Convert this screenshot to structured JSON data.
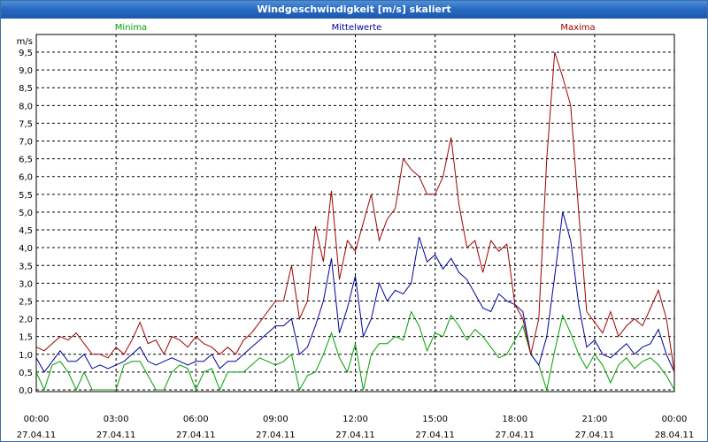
{
  "window": {
    "title": "Windgeschwindigkeit [m/s] skaliert"
  },
  "colors": {
    "titlebar": "#2a6bc2",
    "minima": "#00a000",
    "mittelwerte": "#0000a0",
    "maxima": "#a00000",
    "grid": "#000000"
  },
  "chart_data": {
    "type": "line",
    "title": "Windgeschwindigkeit [m/s] skaliert",
    "ylabel": "m/s",
    "ylim": [
      0,
      9.5
    ],
    "yticks": [
      "0,0",
      "0,5",
      "1,0",
      "1,5",
      "2,0",
      "2,5",
      "3,0",
      "3,5",
      "4,0",
      "4,5",
      "5,0",
      "5,5",
      "6,0",
      "6,5",
      "7,0",
      "7,5",
      "8,0",
      "8,5",
      "9,0",
      "9,5"
    ],
    "xlim_hours": [
      0,
      24
    ],
    "xticks": [
      {
        "time": "00:00",
        "date": "27.04.11"
      },
      {
        "time": "03:00",
        "date": "27.04.11"
      },
      {
        "time": "06:00",
        "date": "27.04.11"
      },
      {
        "time": "09:00",
        "date": "27.04.11"
      },
      {
        "time": "12:00",
        "date": "27.04.11"
      },
      {
        "time": "15:00",
        "date": "27.04.11"
      },
      {
        "time": "18:00",
        "date": "27.04.11"
      },
      {
        "time": "21:00",
        "date": "27.04.11"
      },
      {
        "time": "00:00",
        "date": "28.04.11"
      }
    ],
    "grid": true,
    "legend_position": "top",
    "series": [
      {
        "name": "Minima",
        "color": "#00a000",
        "x": [
          0,
          0.3,
          0.6,
          0.9,
          1.2,
          1.5,
          1.8,
          2.1,
          2.4,
          2.7,
          3.0,
          3.3,
          3.6,
          3.9,
          4.2,
          4.5,
          4.8,
          5.1,
          5.4,
          5.7,
          6.0,
          6.3,
          6.6,
          6.9,
          7.2,
          7.5,
          7.8,
          8.1,
          8.4,
          8.7,
          9.0,
          9.3,
          9.6,
          9.9,
          10.2,
          10.5,
          10.8,
          11.1,
          11.4,
          11.7,
          12.0,
          12.3,
          12.6,
          12.9,
          13.2,
          13.5,
          13.8,
          14.1,
          14.4,
          14.7,
          15.0,
          15.3,
          15.6,
          15.9,
          16.2,
          16.5,
          16.8,
          17.1,
          17.4,
          17.7,
          18.0,
          18.3,
          18.6,
          18.9,
          19.2,
          19.5,
          19.8,
          20.1,
          20.4,
          20.7,
          21.0,
          21.3,
          21.6,
          21.9,
          22.2,
          22.5,
          22.8,
          23.1,
          23.4,
          23.7,
          24.0
        ],
        "values": [
          0.5,
          0.0,
          0.7,
          0.8,
          0.5,
          0.0,
          0.5,
          0.0,
          0.0,
          0.0,
          0.0,
          0.7,
          0.8,
          0.8,
          0.4,
          0.0,
          0.0,
          0.5,
          0.7,
          0.6,
          0.0,
          0.5,
          0.6,
          0.0,
          0.5,
          0.5,
          0.5,
          0.7,
          0.9,
          0.8,
          0.7,
          0.8,
          1.0,
          0.0,
          0.4,
          0.5,
          1.0,
          1.6,
          0.9,
          0.5,
          1.3,
          0.0,
          1.0,
          1.3,
          1.3,
          1.5,
          1.4,
          2.2,
          1.8,
          1.1,
          1.6,
          1.5,
          2.1,
          1.8,
          1.4,
          1.7,
          1.5,
          1.2,
          0.9,
          1.0,
          1.4,
          1.8,
          1.0,
          0.7,
          0.0,
          1.1,
          2.1,
          1.6,
          1.0,
          0.6,
          1.0,
          0.7,
          0.2,
          0.7,
          0.9,
          0.6,
          0.8,
          0.9,
          0.7,
          0.4,
          0.0
        ]
      },
      {
        "name": "Mittelwerte",
        "color": "#0000a0",
        "x": [
          0,
          0.3,
          0.6,
          0.9,
          1.2,
          1.5,
          1.8,
          2.1,
          2.4,
          2.7,
          3.0,
          3.3,
          3.6,
          3.9,
          4.2,
          4.5,
          4.8,
          5.1,
          5.4,
          5.7,
          6.0,
          6.3,
          6.6,
          6.9,
          7.2,
          7.5,
          7.8,
          8.1,
          8.4,
          8.7,
          9.0,
          9.3,
          9.6,
          9.9,
          10.2,
          10.5,
          10.8,
          11.1,
          11.4,
          11.7,
          12.0,
          12.3,
          12.6,
          12.9,
          13.2,
          13.5,
          13.8,
          14.1,
          14.4,
          14.7,
          15.0,
          15.3,
          15.6,
          15.9,
          16.2,
          16.5,
          16.8,
          17.1,
          17.4,
          17.7,
          18.0,
          18.3,
          18.6,
          18.9,
          19.2,
          19.5,
          19.8,
          20.1,
          20.4,
          20.7,
          21.0,
          21.3,
          21.6,
          21.9,
          22.2,
          22.5,
          22.8,
          23.1,
          23.4,
          23.7,
          24.0
        ],
        "values": [
          0.9,
          0.5,
          0.8,
          1.1,
          0.8,
          0.8,
          1.0,
          0.6,
          0.7,
          0.6,
          0.7,
          0.8,
          1.0,
          1.2,
          0.8,
          0.7,
          0.8,
          0.9,
          0.8,
          0.7,
          0.8,
          0.8,
          1.0,
          0.6,
          0.8,
          0.8,
          1.0,
          1.2,
          1.4,
          1.6,
          1.8,
          1.8,
          2.0,
          1.0,
          1.2,
          1.8,
          2.5,
          3.7,
          1.6,
          2.3,
          3.2,
          1.5,
          2.0,
          3.0,
          2.5,
          2.8,
          2.7,
          3.0,
          4.3,
          3.6,
          3.8,
          3.4,
          3.7,
          3.3,
          3.1,
          2.7,
          2.3,
          2.2,
          2.7,
          2.5,
          2.4,
          2.2,
          1.0,
          0.7,
          1.5,
          3.2,
          5.0,
          4.2,
          2.4,
          1.2,
          1.4,
          1.0,
          0.9,
          1.1,
          1.3,
          1.0,
          1.2,
          1.3,
          1.7,
          1.0,
          0.5
        ]
      },
      {
        "name": "Maxima",
        "color": "#a00000",
        "x": [
          0,
          0.3,
          0.6,
          0.9,
          1.2,
          1.5,
          1.8,
          2.1,
          2.4,
          2.7,
          3.0,
          3.3,
          3.6,
          3.9,
          4.2,
          4.5,
          4.8,
          5.1,
          5.4,
          5.7,
          6.0,
          6.3,
          6.6,
          6.9,
          7.2,
          7.5,
          7.8,
          8.1,
          8.4,
          8.7,
          9.0,
          9.3,
          9.6,
          9.9,
          10.2,
          10.5,
          10.8,
          11.1,
          11.4,
          11.7,
          12.0,
          12.3,
          12.6,
          12.9,
          13.2,
          13.5,
          13.8,
          14.1,
          14.4,
          14.7,
          15.0,
          15.3,
          15.6,
          15.9,
          16.2,
          16.5,
          16.8,
          17.1,
          17.4,
          17.7,
          18.0,
          18.3,
          18.6,
          18.9,
          19.2,
          19.5,
          19.8,
          20.1,
          20.4,
          20.7,
          21.0,
          21.3,
          21.6,
          21.9,
          22.2,
          22.5,
          22.8,
          23.1,
          23.4,
          23.7,
          24.0
        ],
        "values": [
          1.2,
          1.1,
          1.3,
          1.5,
          1.4,
          1.6,
          1.3,
          1.0,
          1.0,
          0.9,
          1.2,
          1.0,
          1.4,
          1.9,
          1.3,
          1.4,
          1.0,
          1.5,
          1.4,
          1.2,
          1.5,
          1.3,
          1.2,
          1.0,
          1.2,
          1.0,
          1.4,
          1.6,
          1.9,
          2.2,
          2.5,
          2.5,
          3.5,
          2.0,
          2.5,
          4.6,
          3.6,
          5.6,
          3.1,
          4.2,
          3.9,
          4.7,
          5.5,
          4.2,
          4.8,
          5.1,
          6.5,
          6.2,
          6.0,
          5.5,
          5.5,
          6.0,
          7.1,
          5.2,
          4.0,
          4.2,
          3.3,
          4.2,
          3.9,
          4.1,
          2.4,
          2.0,
          1.0,
          2.0,
          6.5,
          9.5,
          8.8,
          8.0,
          5.0,
          2.2,
          1.9,
          1.6,
          2.2,
          1.5,
          1.8,
          2.0,
          1.8,
          2.3,
          2.8,
          2.0,
          0.5
        ]
      }
    ]
  }
}
